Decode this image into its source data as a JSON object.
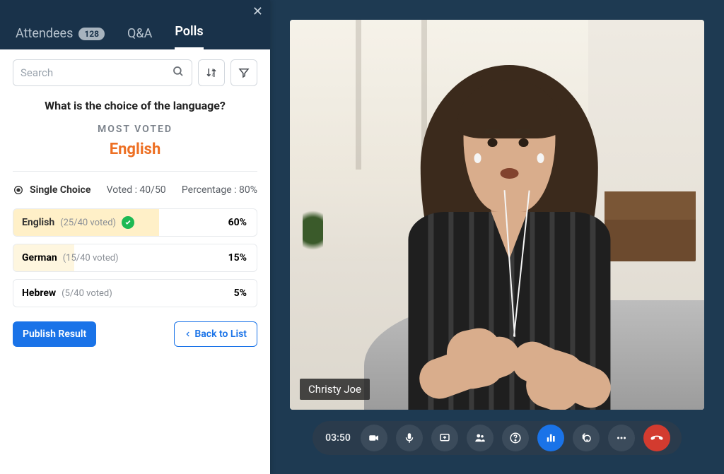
{
  "tabs": {
    "attendees": "Attendees",
    "attendees_count": "128",
    "qa": "Q&A",
    "polls": "Polls"
  },
  "search": {
    "placeholder": "Search"
  },
  "poll": {
    "question": "What is the choice of the language?",
    "most_voted_label": "MOST VOTED",
    "winner": "English",
    "type_label": "Single Choice",
    "voted_label": "Voted : 40/50",
    "percentage_label": "Percentage : 80%",
    "options": [
      {
        "name": "English",
        "votes": "(25/40 voted)",
        "pct": "60%",
        "fill": 60,
        "selected": true
      },
      {
        "name": "German",
        "votes": "(15/40 voted)",
        "pct": "15%",
        "fill": 25,
        "selected": false
      },
      {
        "name": "Hebrew",
        "votes": "(5/40 voted)",
        "pct": "5%",
        "fill": 0,
        "selected": false
      }
    ],
    "publish": "Publish Result",
    "back": "Back to List"
  },
  "video": {
    "presenter": "Christy Joe"
  },
  "toolbar": {
    "time": "03:50"
  }
}
